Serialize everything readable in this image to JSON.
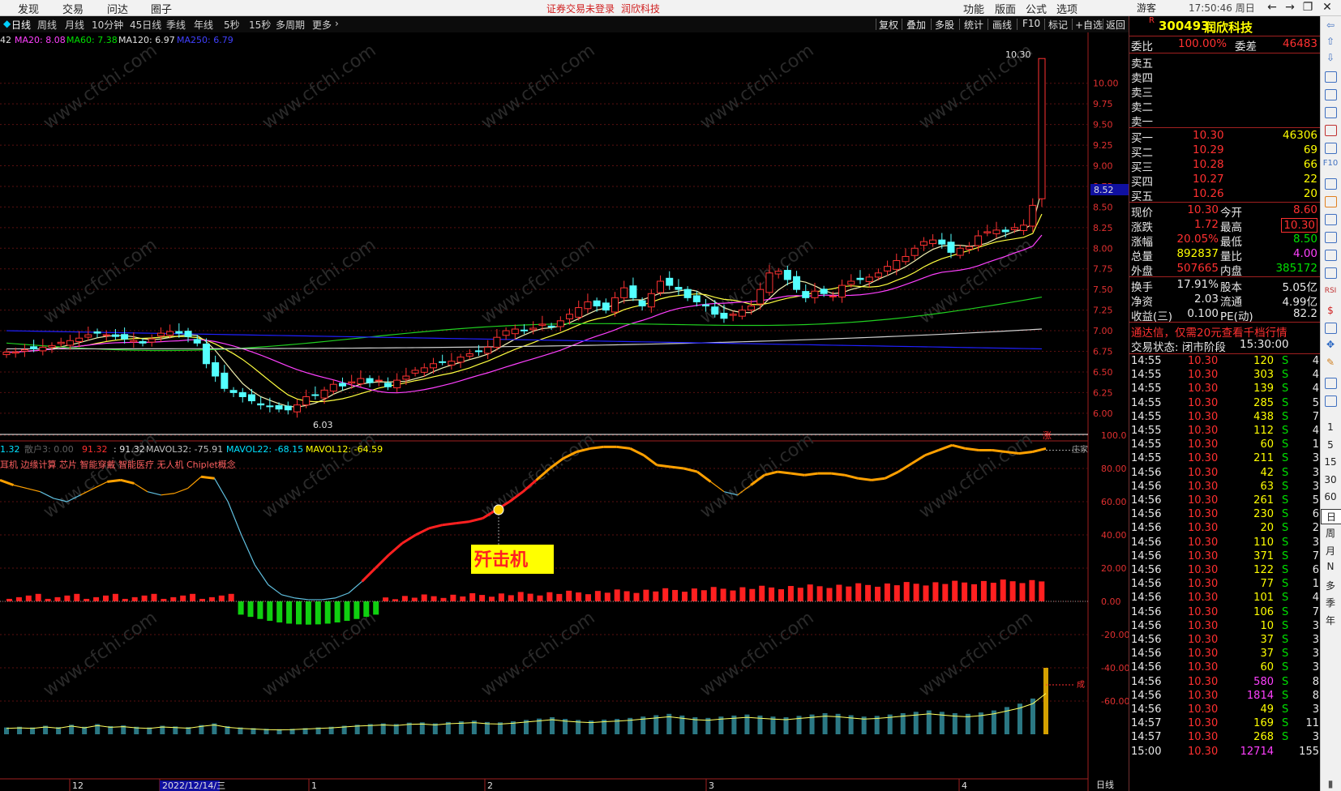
{
  "menu": {
    "items": [
      "发现",
      "交易",
      "问达",
      "圈子"
    ],
    "notice_login": "证券交易未登录",
    "notice_stock": "润欣科技",
    "right_items": [
      "功能",
      "版面",
      "公式",
      "选项"
    ],
    "user": "游客",
    "clock": "17:50:46 周日"
  },
  "periods": [
    "日线",
    "周线",
    "月线",
    "10分钟",
    "45日线",
    "季线",
    "年线",
    "5秒",
    "15秒",
    "多周期",
    "更多"
  ],
  "tools": [
    "复权",
    "叠加",
    "多股",
    "统计",
    "画线",
    "F10",
    "标记",
    "+自选",
    "返回"
  ],
  "ma_legend": {
    "ma5": "42",
    "ma20": "MA20: 8.08",
    "ma60": "MA60: 7.38",
    "ma120": "MA120: 6.97",
    "ma250": "MA250: 6.79"
  },
  "vol_legend": {
    "a": "1.32",
    "b": "散户3: 0.00",
    "c": "91.32",
    "d": ": 91.32",
    "e": "MAVOL32: -75.91",
    "f": "MAVOL22: -68.15",
    "g": "MAVOL12: -64.59"
  },
  "concepts": "耳机 边缘计算 芯片 智能穿戴 智能医疗 无人机 Chiplet概念",
  "price_axis": [
    "10.00",
    "9.75",
    "9.50",
    "9.25",
    "9.00",
    "8.75",
    "8.50",
    "8.25",
    "8.00",
    "7.75",
    "7.50",
    "7.25",
    "7.00",
    "6.75",
    "6.50",
    "6.25",
    "6.00"
  ],
  "price_high": "10.30",
  "price_low": "6.03",
  "crosshair_price": "8.52",
  "zhang_marker": "涨",
  "ind_axis": [
    "100.0",
    "80.00",
    "60.00",
    "40.00",
    "20.00",
    "0.00",
    "-20.00",
    "-40.00",
    "-60.00"
  ],
  "ind_side_labels": [
    "庄家",
    "成"
  ],
  "banner_text": "歼击机",
  "watermark": "www.cfchi.com",
  "date_labels": [
    "12",
    "2022/12/14/三",
    "1",
    "2",
    "3",
    "4"
  ],
  "bottom_axis_label": "日线",
  "quote": {
    "flag": "R",
    "code": "300493",
    "name": "润欣科技",
    "weibi_label": "委比",
    "weibi": "100.00%",
    "weicha_label": "委差",
    "weicha": "46483",
    "asks": [
      "卖五",
      "卖四",
      "卖三",
      "卖二",
      "卖一"
    ],
    "bids": [
      {
        "label": "买一",
        "price": "10.30",
        "vol": "46306"
      },
      {
        "label": "买二",
        "price": "10.29",
        "vol": "69"
      },
      {
        "label": "买三",
        "price": "10.28",
        "vol": "66"
      },
      {
        "label": "买四",
        "price": "10.27",
        "vol": "22"
      },
      {
        "label": "买五",
        "price": "10.26",
        "vol": "20"
      }
    ],
    "stats": [
      {
        "l1": "现价",
        "v1": "10.30",
        "l2": "今开",
        "v2": "8.60",
        "c1": "r",
        "c2": "r"
      },
      {
        "l1": "涨跌",
        "v1": "1.72",
        "l2": "最高",
        "v2": "10.30",
        "c1": "r",
        "c2": "r"
      },
      {
        "l1": "涨幅",
        "v1": "20.05%",
        "l2": "最低",
        "v2": "8.50",
        "c1": "r",
        "c2": "g"
      },
      {
        "l1": "总量",
        "v1": "892837",
        "l2": "量比",
        "v2": "4.00",
        "c1": "y",
        "c2": "m"
      },
      {
        "l1": "外盘",
        "v1": "507665",
        "l2": "内盘",
        "v2": "385172",
        "c1": "r",
        "c2": "g"
      }
    ],
    "stats2": [
      {
        "l1": "换手",
        "v1": "17.91%",
        "l2": "股本",
        "v2": "5.05亿"
      },
      {
        "l1": "净资",
        "v1": "2.03",
        "l2": "流通",
        "v2": "4.99亿"
      },
      {
        "l1": "收益(三)",
        "v1": "0.100",
        "l2": "PE(动)",
        "v2": "82.2"
      }
    ],
    "ad": "通达信，仅需20元查看千档行情",
    "status_label": "交易状态: 闭市阶段",
    "status_time": "15:30:00"
  },
  "ticks": [
    {
      "t": "14:55",
      "p": "10.30",
      "v": "120",
      "s": "S",
      "n": "4"
    },
    {
      "t": "14:55",
      "p": "10.30",
      "v": "303",
      "s": "S",
      "n": "4"
    },
    {
      "t": "14:55",
      "p": "10.30",
      "v": "139",
      "s": "S",
      "n": "4"
    },
    {
      "t": "14:55",
      "p": "10.30",
      "v": "285",
      "s": "S",
      "n": "5"
    },
    {
      "t": "14:55",
      "p": "10.30",
      "v": "438",
      "s": "S",
      "n": "7"
    },
    {
      "t": "14:55",
      "p": "10.30",
      "v": "112",
      "s": "S",
      "n": "4"
    },
    {
      "t": "14:55",
      "p": "10.30",
      "v": "60",
      "s": "S",
      "n": "1"
    },
    {
      "t": "14:55",
      "p": "10.30",
      "v": "211",
      "s": "S",
      "n": "3"
    },
    {
      "t": "14:56",
      "p": "10.30",
      "v": "42",
      "s": "S",
      "n": "3"
    },
    {
      "t": "14:56",
      "p": "10.30",
      "v": "63",
      "s": "S",
      "n": "3"
    },
    {
      "t": "14:56",
      "p": "10.30",
      "v": "261",
      "s": "S",
      "n": "5"
    },
    {
      "t": "14:56",
      "p": "10.30",
      "v": "230",
      "s": "S",
      "n": "6"
    },
    {
      "t": "14:56",
      "p": "10.30",
      "v": "20",
      "s": "S",
      "n": "2"
    },
    {
      "t": "14:56",
      "p": "10.30",
      "v": "110",
      "s": "S",
      "n": "3"
    },
    {
      "t": "14:56",
      "p": "10.30",
      "v": "371",
      "s": "S",
      "n": "7"
    },
    {
      "t": "14:56",
      "p": "10.30",
      "v": "122",
      "s": "S",
      "n": "6"
    },
    {
      "t": "14:56",
      "p": "10.30",
      "v": "77",
      "s": "S",
      "n": "1"
    },
    {
      "t": "14:56",
      "p": "10.30",
      "v": "101",
      "s": "S",
      "n": "4"
    },
    {
      "t": "14:56",
      "p": "10.30",
      "v": "106",
      "s": "S",
      "n": "7"
    },
    {
      "t": "14:56",
      "p": "10.30",
      "v": "10",
      "s": "S",
      "n": "3"
    },
    {
      "t": "14:56",
      "p": "10.30",
      "v": "37",
      "s": "S",
      "n": "3"
    },
    {
      "t": "14:56",
      "p": "10.30",
      "v": "37",
      "s": "S",
      "n": "3"
    },
    {
      "t": "14:56",
      "p": "10.30",
      "v": "60",
      "s": "S",
      "n": "3"
    },
    {
      "t": "14:56",
      "p": "10.30",
      "v": "580",
      "s": "S",
      "n": "8",
      "hi": true
    },
    {
      "t": "14:56",
      "p": "10.30",
      "v": "1814",
      "s": "S",
      "n": "8",
      "hi": true
    },
    {
      "t": "14:56",
      "p": "10.30",
      "v": "49",
      "s": "S",
      "n": "3"
    },
    {
      "t": "14:57",
      "p": "10.30",
      "v": "169",
      "s": "S",
      "n": "11"
    },
    {
      "t": "14:57",
      "p": "10.30",
      "v": "268",
      "s": "S",
      "n": "3"
    },
    {
      "t": "15:00",
      "p": "10.30",
      "v": "12714",
      "s": "",
      "n": "155",
      "hi": true
    }
  ],
  "sidebar_labels": [
    "RSI",
    "F10",
    "1",
    "5",
    "15",
    "30",
    "60",
    "日",
    "周",
    "月",
    "N",
    "多",
    "季",
    "年"
  ],
  "chart_data": {
    "type": "candlestick",
    "y_range": [
      6.0,
      10.3
    ],
    "last": {
      "open": 8.6,
      "high": 10.3,
      "low": 8.5,
      "close": 10.3
    },
    "closes": [
      6.74,
      6.74,
      6.77,
      6.78,
      6.8,
      6.82,
      6.86,
      6.88,
      6.91,
      6.95,
      6.97,
      6.95,
      6.93,
      6.9,
      6.88,
      6.85,
      6.9,
      6.97,
      6.99,
      6.97,
      6.93,
      6.85,
      6.6,
      6.45,
      6.3,
      6.25,
      6.2,
      6.15,
      6.1,
      6.08,
      6.05,
      6.04,
      6.1,
      6.2,
      6.22,
      6.28,
      6.35,
      6.33,
      6.38,
      6.42,
      6.37,
      6.4,
      6.32,
      6.4,
      6.45,
      6.52,
      6.55,
      6.6,
      6.62,
      6.63,
      6.68,
      6.72,
      6.75,
      6.8,
      6.92,
      7.0,
      7.02,
      7.0,
      7.03,
      7.08,
      7.05,
      7.12,
      7.2,
      7.28,
      7.35,
      7.3,
      7.25,
      7.4,
      7.52,
      7.4,
      7.3,
      7.45,
      7.6,
      7.55,
      7.5,
      7.4,
      7.35,
      7.3,
      7.2,
      7.15,
      7.2,
      7.25,
      7.3,
      7.5,
      7.7,
      7.72,
      7.62,
      7.5,
      7.4,
      7.48,
      7.45,
      7.42,
      7.55,
      7.6,
      7.62,
      7.65,
      7.7,
      7.78,
      7.85,
      7.9,
      8.0,
      8.08,
      8.1,
      8.05,
      7.95,
      8.0,
      8.02,
      8.15,
      8.2,
      8.22,
      8.2,
      8.25,
      8.28,
      8.52,
      10.3
    ],
    "indicator": [
      73,
      70,
      68,
      66,
      62,
      60,
      64,
      68,
      72,
      73,
      71,
      66,
      64,
      65,
      68,
      75,
      74,
      60,
      40,
      22,
      10,
      4,
      2,
      1,
      1,
      2,
      5,
      12,
      20,
      28,
      35,
      40,
      44,
      46,
      47,
      48,
      50,
      55,
      60,
      66,
      73,
      80,
      86,
      90,
      92,
      93,
      93,
      92,
      88,
      82,
      81,
      80,
      78,
      72,
      66,
      64,
      70,
      76,
      78,
      77,
      76,
      77,
      77,
      76,
      74,
      73,
      74,
      78,
      83,
      88,
      91,
      94,
      92,
      91,
      91,
      90,
      89,
      90,
      92
    ],
    "volume": [
      2,
      2.2,
      2.0,
      2.5,
      2.1,
      2.8,
      2.2,
      3.0,
      2.4,
      2.6,
      2.2,
      2.0,
      2.5,
      2.3,
      2.1,
      2.7,
      3.2,
      2.4,
      2.0,
      1.8,
      1.6,
      1.5,
      1.6,
      1.8,
      2.0,
      2.2,
      2.5,
      2.8,
      3.0,
      3.2,
      3.0,
      3.4,
      3.5,
      3.2,
      3.6,
      3.8,
      4.0,
      3.6,
      3.5,
      3.8,
      4.2,
      4.6,
      5.0,
      4.5,
      4.2,
      4.0,
      4.3,
      4.5,
      4.8,
      5.2,
      5.6,
      6.0,
      5.5,
      5.0,
      4.8,
      5.2,
      5.5,
      5.8,
      5.5,
      5.2,
      5.0,
      5.4,
      5.8,
      6.2,
      6.0,
      5.6,
      5.2,
      5.4,
      5.8,
      6.2,
      6.6,
      7.0,
      6.6,
      6.2,
      6.0,
      6.4,
      7.0,
      8.0,
      9.0,
      10.5,
      14.0
    ]
  }
}
